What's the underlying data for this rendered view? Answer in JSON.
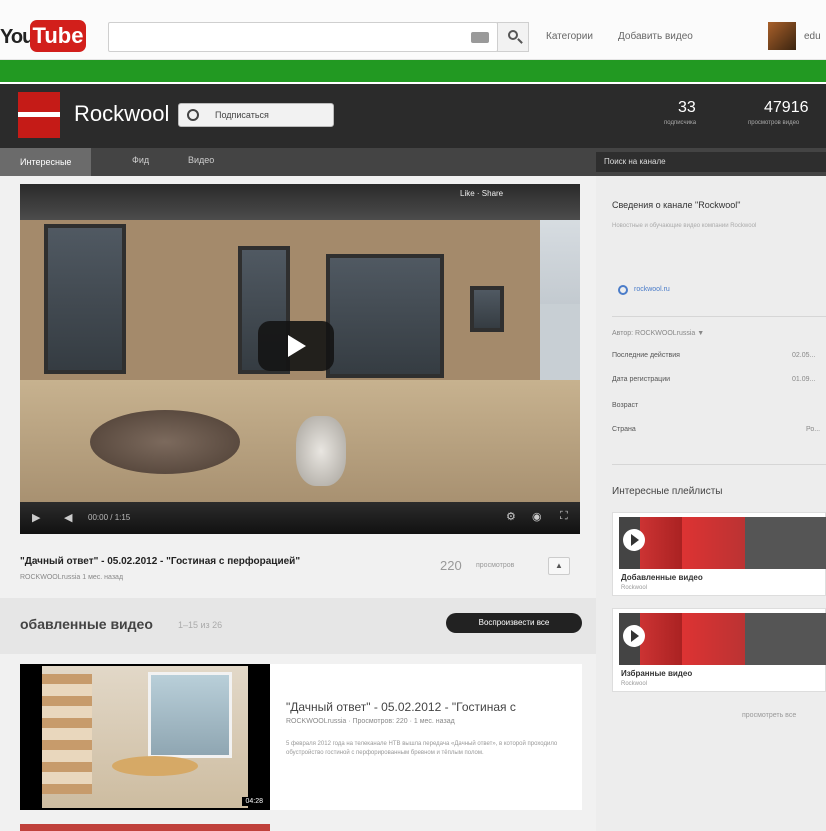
{
  "masthead": {
    "logo_you": "You",
    "logo_tube": "Tube",
    "nav_categories": "Категории",
    "nav_add_video": "Добавить видео",
    "user": "edu"
  },
  "channel": {
    "name": "Rockwool",
    "subscribe_label": "Подписаться",
    "stats": [
      {
        "value": "33",
        "label": "подписчика"
      },
      {
        "value": "47916",
        "label": "просмотров видео"
      }
    ],
    "tabs": [
      {
        "label": "Интересные"
      },
      {
        "label": "Фид"
      },
      {
        "label": "Видео"
      }
    ],
    "search_placeholder": "Поиск на канале"
  },
  "player": {
    "top_actions": "Like · Share",
    "time": "00:00 / 1:15",
    "title": "\"Дачный ответ\" - 05.02.2012 - \"Гостиная с перфорацией\"",
    "meta": "ROCKWOOLrussia 1 мес. назад",
    "views": "220",
    "views_label": "просмотров"
  },
  "added_section": {
    "title": "обавленные видео",
    "count": "1–15 из 26",
    "play_all": "Воспроизвести все",
    "items": [
      {
        "title": "\"Дачный ответ\" - 05.02.2012 - \"Гостиная с",
        "meta": "ROCKWOOLrussia · Просмотров: 220 · 1 мес. назад",
        "description": "5 февраля 2012 года на телеканале НТВ вышла передача «Дачный ответ», в которой проходило обустройство гостиной с перфорированным бревном и тёплым полом.",
        "duration": "04:28"
      }
    ]
  },
  "sidebar": {
    "about_title": "Сведения о канале \"Rockwool\"",
    "about_text": "Новостные и обучающие видео компании Rockwool",
    "site_link": "rockwool.ru",
    "author": "Автор: ROCKWOOLrussia ▼",
    "details": [
      {
        "key": "Последние действия",
        "value": "02.05..."
      },
      {
        "key": "Дата регистрации",
        "value": "01.09..."
      },
      {
        "key": "Возраст",
        "value": ""
      },
      {
        "key": "Страна",
        "value": "Ро..."
      }
    ],
    "playlists_title": "Интересные плейлисты",
    "playlists": [
      {
        "name": "Добавленные видео",
        "owner": "Rockwool"
      },
      {
        "name": "Избранные видео",
        "owner": "Rockwool"
      }
    ],
    "view_all": "просмотреть все"
  }
}
